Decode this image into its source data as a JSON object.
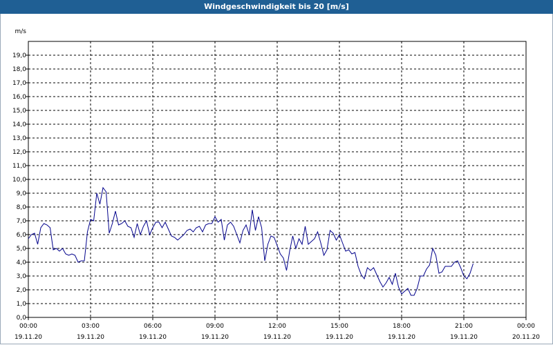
{
  "window": {
    "title": "Windgeschwindigkeit bis 20 [m/s]"
  },
  "chart_data": {
    "type": "line",
    "ylabel": "m/s",
    "ylim": [
      0,
      20
    ],
    "grid": true,
    "yticks": [
      "0,0",
      "1,0",
      "2,0",
      "3,0",
      "4,0",
      "5,0",
      "6,0",
      "7,0",
      "8,0",
      "9,0",
      "10,0",
      "11,0",
      "12,0",
      "13,0",
      "14,0",
      "15,0",
      "16,0",
      "17,0",
      "18,0",
      "19,0"
    ],
    "xticks": [
      {
        "time": "00:00",
        "date": "19.11.20"
      },
      {
        "time": "03:00",
        "date": "19.11.20"
      },
      {
        "time": "06:00",
        "date": "19.11.20"
      },
      {
        "time": "09:00",
        "date": "19.11.20"
      },
      {
        "time": "12:00",
        "date": "19.11.20"
      },
      {
        "time": "15:00",
        "date": "19.11.20"
      },
      {
        "time": "18:00",
        "date": "19.11.20"
      },
      {
        "time": "21:00",
        "date": "19.11.20"
      },
      {
        "time": "00:00",
        "date": "20.11.20"
      }
    ],
    "xlim_hours": [
      0,
      24
    ],
    "line_color": "#00008b",
    "series": [
      {
        "name": "",
        "points": [
          [
            0.0,
            5.7
          ],
          [
            0.15,
            6.0
          ],
          [
            0.3,
            6.1
          ],
          [
            0.45,
            5.3
          ],
          [
            0.6,
            6.5
          ],
          [
            0.75,
            6.8
          ],
          [
            0.9,
            6.7
          ],
          [
            1.05,
            6.5
          ],
          [
            1.2,
            4.9
          ],
          [
            1.35,
            5.0
          ],
          [
            1.5,
            4.8
          ],
          [
            1.65,
            5.0
          ],
          [
            1.8,
            4.6
          ],
          [
            1.95,
            4.5
          ],
          [
            2.1,
            4.6
          ],
          [
            2.25,
            4.5
          ],
          [
            2.4,
            4.0
          ],
          [
            2.55,
            4.1
          ],
          [
            2.7,
            4.1
          ],
          [
            2.85,
            6.2
          ],
          [
            3.0,
            7.1
          ],
          [
            3.15,
            7.0
          ],
          [
            3.3,
            9.0
          ],
          [
            3.45,
            8.2
          ],
          [
            3.6,
            9.4
          ],
          [
            3.75,
            9.1
          ],
          [
            3.9,
            6.1
          ],
          [
            4.05,
            6.8
          ],
          [
            4.2,
            7.7
          ],
          [
            4.35,
            6.7
          ],
          [
            4.5,
            6.8
          ],
          [
            4.65,
            7.0
          ],
          [
            4.8,
            6.6
          ],
          [
            4.95,
            6.5
          ],
          [
            5.1,
            5.8
          ],
          [
            5.25,
            6.8
          ],
          [
            5.4,
            6.0
          ],
          [
            5.55,
            6.6
          ],
          [
            5.7,
            7.0
          ],
          [
            5.85,
            6.0
          ],
          [
            6.0,
            6.5
          ],
          [
            6.15,
            6.9
          ],
          [
            6.3,
            6.9
          ],
          [
            6.45,
            6.5
          ],
          [
            6.6,
            6.9
          ],
          [
            6.75,
            6.4
          ],
          [
            6.9,
            5.9
          ],
          [
            7.05,
            5.8
          ],
          [
            7.2,
            5.6
          ],
          [
            7.35,
            5.8
          ],
          [
            7.5,
            6.0
          ],
          [
            7.65,
            6.3
          ],
          [
            7.8,
            6.4
          ],
          [
            7.95,
            6.2
          ],
          [
            8.1,
            6.5
          ],
          [
            8.25,
            6.6
          ],
          [
            8.4,
            6.2
          ],
          [
            8.55,
            6.7
          ],
          [
            8.7,
            6.8
          ],
          [
            8.85,
            6.8
          ],
          [
            9.0,
            7.3
          ],
          [
            9.15,
            6.9
          ],
          [
            9.3,
            7.1
          ],
          [
            9.45,
            5.6
          ],
          [
            9.6,
            6.7
          ],
          [
            9.75,
            6.9
          ],
          [
            9.9,
            6.6
          ],
          [
            10.05,
            6.0
          ],
          [
            10.2,
            5.4
          ],
          [
            10.35,
            6.3
          ],
          [
            10.5,
            6.7
          ],
          [
            10.65,
            6.0
          ],
          [
            10.8,
            7.8
          ],
          [
            10.95,
            6.3
          ],
          [
            11.1,
            7.3
          ],
          [
            11.25,
            6.5
          ],
          [
            11.4,
            4.1
          ],
          [
            11.55,
            5.3
          ],
          [
            11.7,
            5.9
          ],
          [
            11.85,
            5.8
          ],
          [
            12.0,
            5.2
          ],
          [
            12.15,
            4.6
          ],
          [
            12.3,
            4.3
          ],
          [
            12.45,
            3.4
          ],
          [
            12.6,
            4.8
          ],
          [
            12.75,
            5.9
          ],
          [
            12.9,
            5.0
          ],
          [
            13.05,
            5.7
          ],
          [
            13.2,
            5.3
          ],
          [
            13.35,
            6.6
          ],
          [
            13.5,
            5.3
          ],
          [
            13.65,
            5.5
          ],
          [
            13.8,
            5.7
          ],
          [
            13.95,
            6.2
          ],
          [
            14.1,
            5.4
          ],
          [
            14.25,
            4.5
          ],
          [
            14.4,
            4.9
          ],
          [
            14.55,
            6.3
          ],
          [
            14.7,
            6.1
          ],
          [
            14.85,
            5.6
          ],
          [
            15.0,
            6.0
          ],
          [
            15.15,
            5.4
          ],
          [
            15.3,
            4.8
          ],
          [
            15.45,
            4.9
          ],
          [
            15.6,
            4.6
          ],
          [
            15.75,
            4.7
          ],
          [
            15.9,
            3.7
          ],
          [
            16.05,
            3.1
          ],
          [
            16.2,
            2.8
          ],
          [
            16.35,
            3.6
          ],
          [
            16.5,
            3.4
          ],
          [
            16.65,
            3.6
          ],
          [
            16.8,
            3.1
          ],
          [
            16.95,
            2.6
          ],
          [
            17.1,
            2.2
          ],
          [
            17.25,
            2.5
          ],
          [
            17.4,
            2.9
          ],
          [
            17.55,
            2.4
          ],
          [
            17.7,
            3.2
          ],
          [
            17.85,
            2.2
          ],
          [
            18.0,
            1.7
          ],
          [
            18.15,
            1.9
          ],
          [
            18.3,
            2.1
          ],
          [
            18.45,
            1.6
          ],
          [
            18.6,
            1.6
          ],
          [
            18.75,
            2.1
          ],
          [
            18.9,
            3.0
          ],
          [
            19.05,
            3.0
          ],
          [
            19.2,
            3.5
          ],
          [
            19.35,
            3.8
          ],
          [
            19.5,
            5.0
          ],
          [
            19.65,
            4.5
          ],
          [
            19.8,
            3.2
          ],
          [
            19.95,
            3.3
          ],
          [
            20.1,
            3.7
          ],
          [
            20.25,
            3.7
          ],
          [
            20.4,
            3.7
          ],
          [
            20.55,
            4.0
          ],
          [
            20.7,
            4.1
          ],
          [
            20.85,
            3.6
          ],
          [
            21.0,
            3.0
          ],
          [
            21.15,
            2.8
          ],
          [
            21.3,
            3.2
          ],
          [
            21.45,
            3.9
          ]
        ]
      }
    ]
  }
}
